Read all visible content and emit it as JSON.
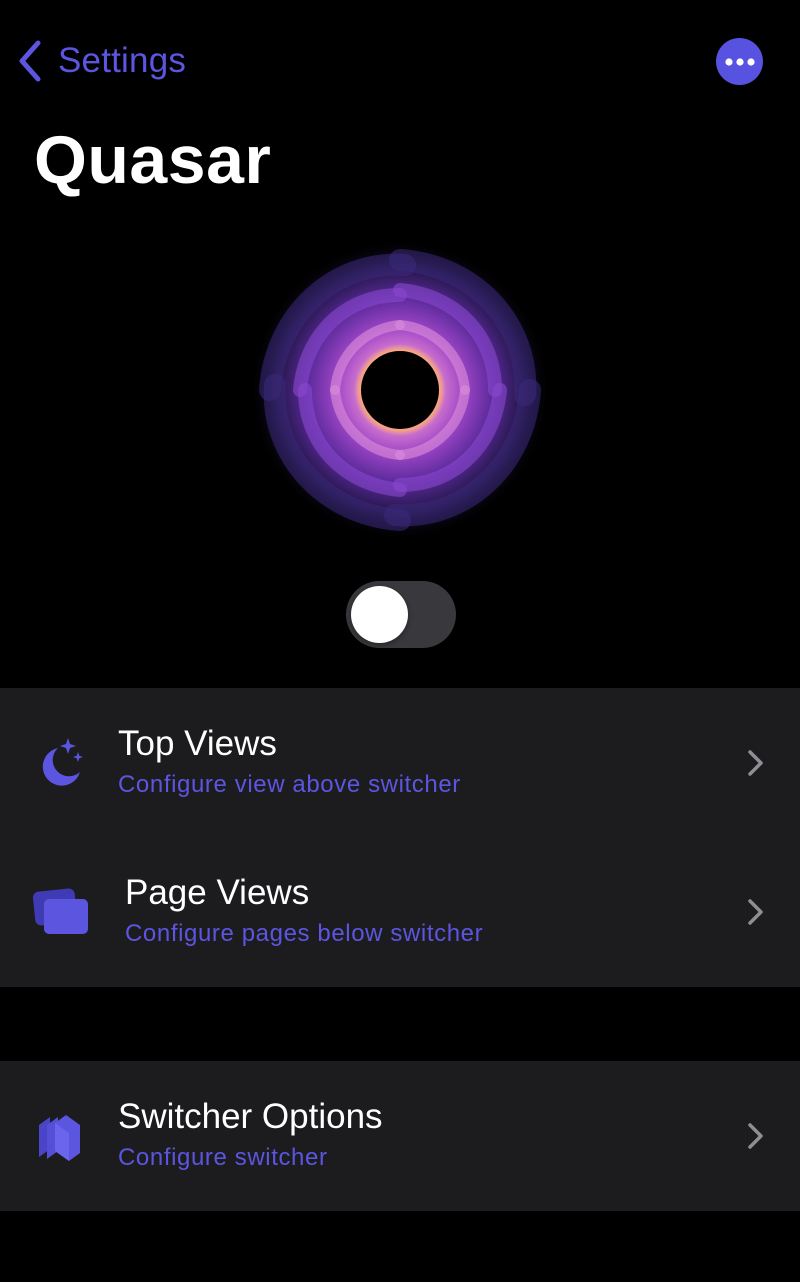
{
  "nav": {
    "back_label": "Settings",
    "back_icon": "chevron-left-icon",
    "more_icon": "ellipsis-icon"
  },
  "page": {
    "title": "Quasar"
  },
  "hero": {
    "icon": "quasar-swirl-logo"
  },
  "toggle": {
    "state": "off"
  },
  "sections": [
    {
      "rows": [
        {
          "icon": "moon-stars-icon",
          "title": "Top Views",
          "subtitle": "Configure view above switcher"
        },
        {
          "icon": "stacked-pages-icon",
          "title": "Page Views",
          "subtitle": "Configure pages below switcher"
        }
      ]
    },
    {
      "rows": [
        {
          "icon": "stacked-cards-icon",
          "title": "Switcher Options",
          "subtitle": "Configure switcher"
        }
      ]
    }
  ],
  "colors": {
    "accent": "#5b55e0",
    "background": "#000000",
    "group_background": "#1c1c1e",
    "chevron": "#8e8e93",
    "toggle_off": "#39393d"
  }
}
